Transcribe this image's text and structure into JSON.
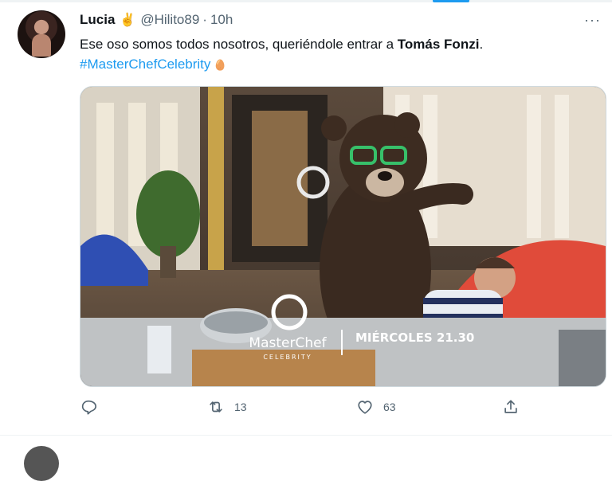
{
  "tweet": {
    "author_name": "Lucia",
    "author_emoji": "✌",
    "handle": "@Hilito89",
    "separator": "·",
    "time": "10h",
    "more_label": "···",
    "text_part1": "Ese oso somos todos nosotros, queriéndole entrar a ",
    "text_bold": "Tomás Fonzi",
    "text_part2": ".",
    "hashtag": "#MasterChefCelebrity",
    "hashtag_emoji": "🥚",
    "media": {
      "brand_line1": "MasterChef",
      "brand_line2": "CELEBRITY",
      "schedule_text": "MIÉRCOLES 21.30"
    },
    "actions": {
      "reply_count": "",
      "retweet_count": "13",
      "like_count": "63"
    }
  },
  "colors": {
    "accent": "#1d9bf0",
    "text": "#0f1419",
    "secondary": "#536471",
    "divider": "#eff3f4"
  },
  "icons": [
    "more-icon",
    "reply-icon",
    "retweet-icon",
    "like-icon",
    "share-icon"
  ]
}
